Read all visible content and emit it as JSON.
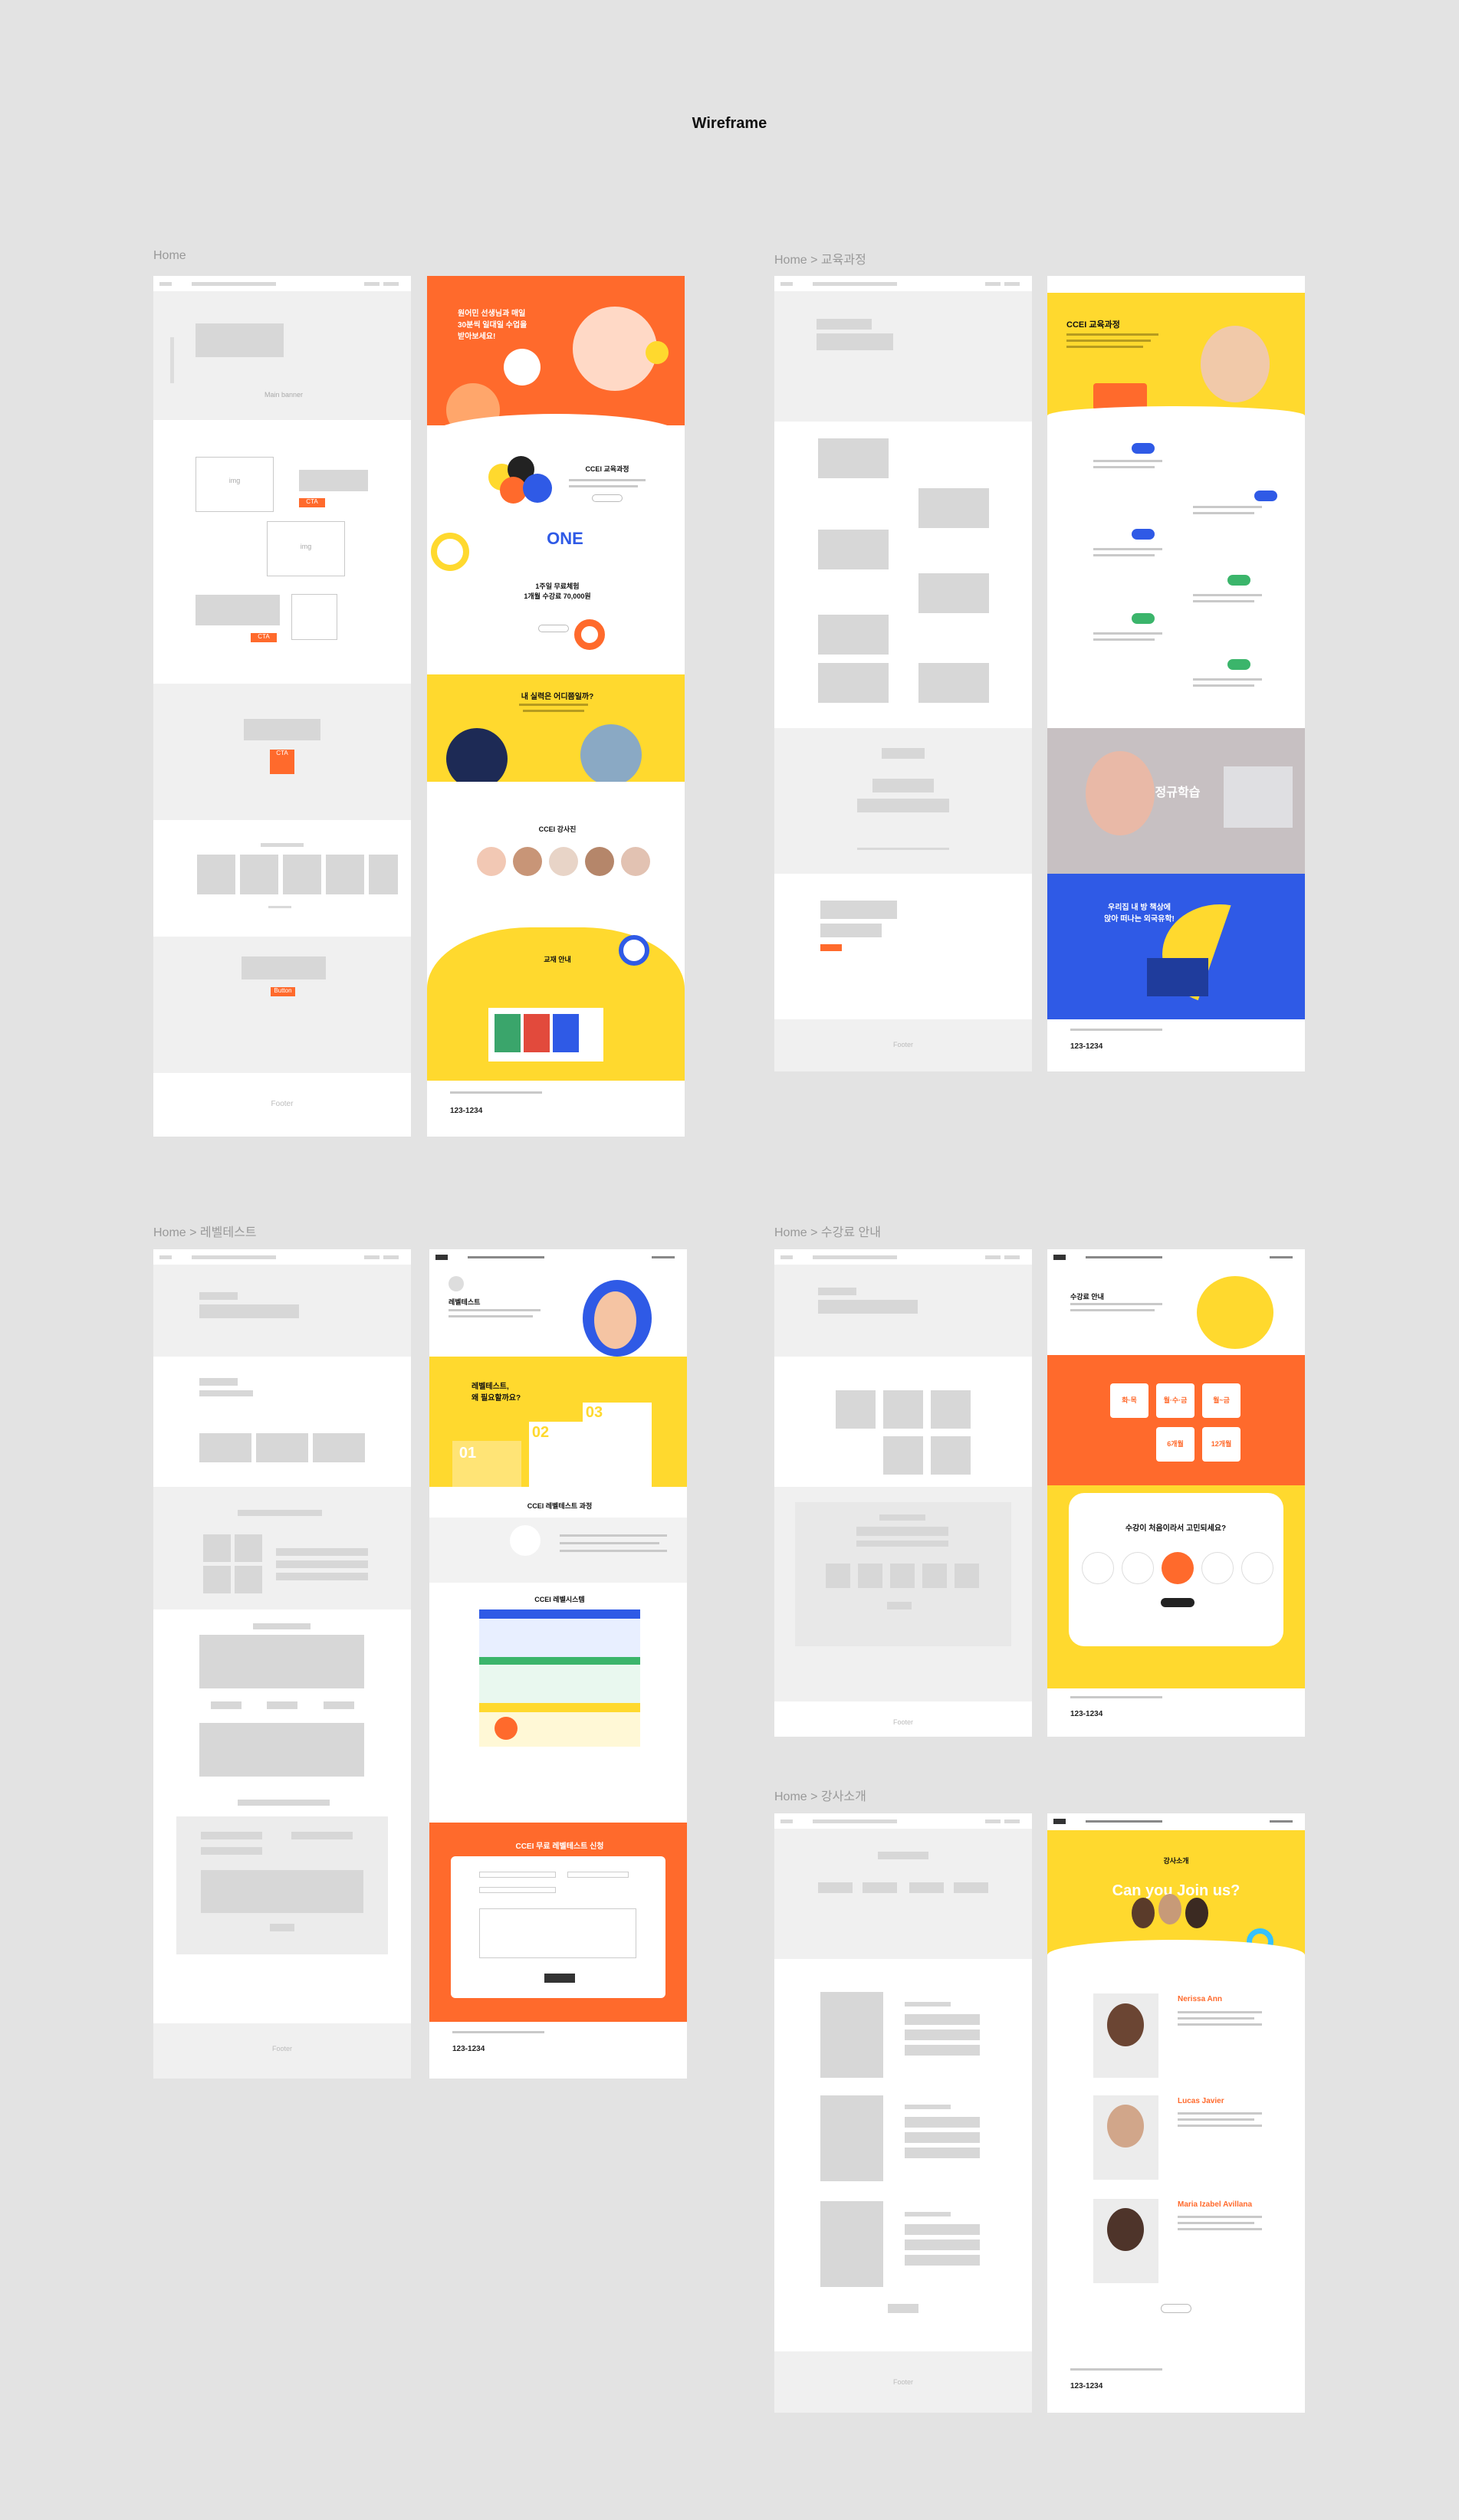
{
  "title": "Wireframe",
  "sections": {
    "home": "Home",
    "course": "Home > 교육과정",
    "level": "Home > 레벨테스트",
    "tuition": "Home > 수강료 안내",
    "teachers": "Home > 강사소개"
  },
  "home_wire": {
    "main_banner": "Main banner",
    "img": "img",
    "img_outline": "img",
    "cta": "CTA",
    "button": "Button",
    "footer": "Footer"
  },
  "home_design": {
    "hero": "원어민 선생님과 매일\n30분씩 일대일 수업을\n받아보세요!",
    "course_title": "CCEI 교육과정",
    "one": "ONE",
    "trial": "1주일 무료체험\n1개월 수강료 70,000원",
    "level_q": "내 실력은 어디쯤일까?",
    "teachers_title": "CCEI 강사진",
    "book_title": "교재 안내",
    "tel": "123-1234"
  },
  "course_design": {
    "title": "CCEI 교육과정",
    "regular": "정규학습",
    "promo": "우리집 내 방 책상에\n앉아 떠나는 외국유학!",
    "tel": "123-1234"
  },
  "level_design": {
    "title": "레벨테스트",
    "why": "레벨테스트,\n왜 필요할까요?",
    "steps": [
      "01",
      "02",
      "03"
    ],
    "process": "CCEI 레벨테스트 과정",
    "system": "CCEI 레벨시스템",
    "apply": "CCEI 무료 레벨테스트 신청",
    "tel": "123-1234"
  },
  "tuition_design": {
    "title": "수강료 안내",
    "tiers": [
      "화·목",
      "월·수·금",
      "월~금",
      "6개월",
      "12개월"
    ],
    "question": "수강이 처음이라서 고민되세요?",
    "tel": "123-1234"
  },
  "teachers_design": {
    "hero": "Can you Join us?",
    "label": "강사소개",
    "names": [
      "Nerissa Ann",
      "Lucas Javier",
      "Maria Izabel Avillana"
    ],
    "tel": "123-1234"
  },
  "colors": {
    "orange": "#ff6a2c",
    "yellow": "#ffd92e",
    "blue": "#2f5ae6",
    "bg": "#e3e3e3"
  }
}
